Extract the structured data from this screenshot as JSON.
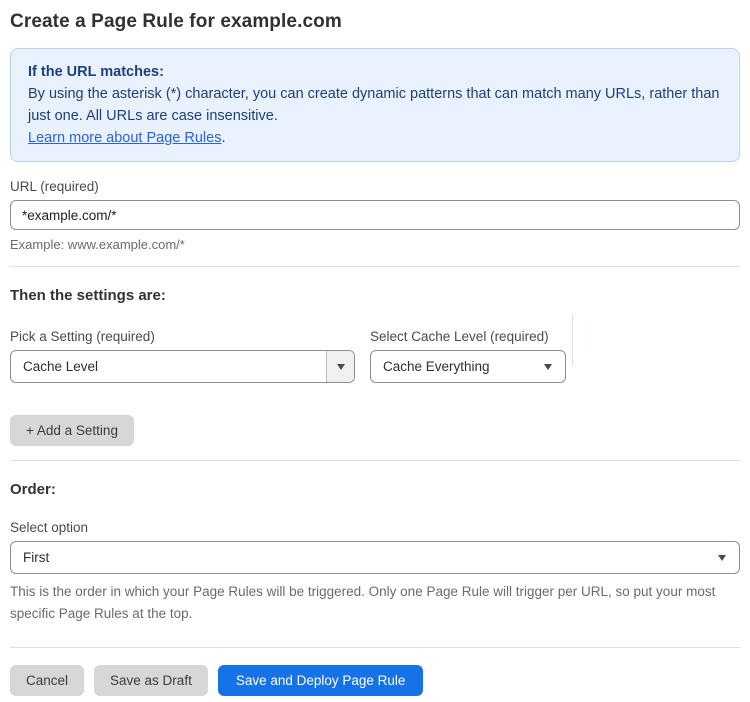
{
  "page": {
    "title": "Create a Page Rule for example.com"
  },
  "info_box": {
    "heading": "If the URL matches:",
    "body": "By using the asterisk (*) character, you can create dynamic patterns that can match many URLs, rather than just one. All URLs are case insensitive.",
    "link_label": "Learn more about Page Rules",
    "link_suffix": "."
  },
  "url_field": {
    "label": "URL (required)",
    "value": "*example.com/*",
    "example": "Example: www.example.com/*"
  },
  "settings_section": {
    "heading": "Then the settings are:",
    "setting_select": {
      "label": "Pick a Setting (required)",
      "value": "Cache Level"
    },
    "cache_level_select": {
      "label": "Select Cache Level (required)",
      "value": "Cache Everything"
    },
    "add_setting_label": "+ Add a Setting"
  },
  "order_section": {
    "heading": "Order:",
    "select_label": "Select option",
    "value": "First",
    "help": "This is the order in which your Page Rules will be triggered. Only one Page Rule will trigger per URL, so put your most specific Page Rules at the top."
  },
  "actions": {
    "cancel": "Cancel",
    "save_draft": "Save as Draft",
    "save_deploy": "Save and Deploy Page Rule"
  },
  "colors": {
    "info_bg": "#e9f2fc",
    "info_border": "#b8d4f0",
    "info_text": "#1d3f7d",
    "link": "#2c63d6",
    "primary_button": "#1672e6",
    "secondary_button": "#d7d7d7"
  },
  "icons": {
    "dropdown_arrow": "triangle-down"
  }
}
